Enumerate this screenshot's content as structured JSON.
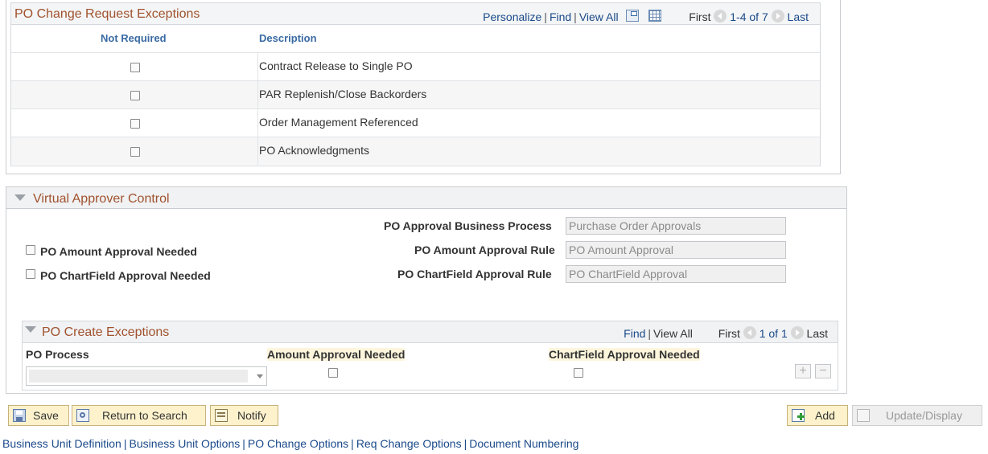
{
  "top_grid": {
    "title": "PO Change Request Exceptions",
    "nav": {
      "personalize": "Personalize",
      "find": "Find",
      "view_all": "View All",
      "first": "First",
      "range": "1-4 of 7",
      "last": "Last"
    },
    "columns": [
      "Not Required",
      "Description"
    ],
    "rows": [
      {
        "not_required": false,
        "description": "Contract Release to Single PO"
      },
      {
        "not_required": false,
        "description": "PAR Replenish/Close Backorders"
      },
      {
        "not_required": false,
        "description": "Order Management Referenced"
      },
      {
        "not_required": false,
        "description": "PO Acknowledgments"
      }
    ]
  },
  "virtual_approver": {
    "title": "Virtual Approver Control",
    "po_amount_approval_needed": {
      "label": "PO Amount Approval Needed",
      "checked": false
    },
    "po_chartfield_approval_needed": {
      "label": "PO ChartField Approval Needed",
      "checked": false
    },
    "po_approval_business_process": {
      "label": "PO Approval Business Process",
      "value": "Purchase Order Approvals"
    },
    "po_amount_approval_rule": {
      "label": "PO Amount Approval Rule",
      "value": "PO Amount Approval"
    },
    "po_chartfield_approval_rule": {
      "label": "PO ChartField Approval Rule",
      "value": "PO ChartField Approval"
    }
  },
  "po_create_exceptions": {
    "title": "PO Create Exceptions",
    "nav": {
      "find": "Find",
      "view_all": "View All",
      "first": "First",
      "range": "1 of 1",
      "last": "Last"
    },
    "columns": [
      "PO Process",
      "Amount Approval Needed",
      "ChartField Approval Needed"
    ],
    "row": {
      "po_process": "",
      "amount_approval_needed": false,
      "chartfield_approval_needed": false
    },
    "add_row": "+",
    "delete_row": "−"
  },
  "toolbar": {
    "save": "Save",
    "return_to_search": "Return to Search",
    "notify": "Notify",
    "add": "Add",
    "update_display": "Update/Display"
  },
  "footer_links": [
    "Business Unit Definition",
    "Business Unit Options",
    "PO Change Options",
    "Req Change Options",
    "Document Numbering"
  ],
  "colors": {
    "section_title": "#a0522d",
    "link": "#1a4a8a",
    "column_header": "#3a6aa3",
    "button_bg": "#fdf2cc"
  }
}
